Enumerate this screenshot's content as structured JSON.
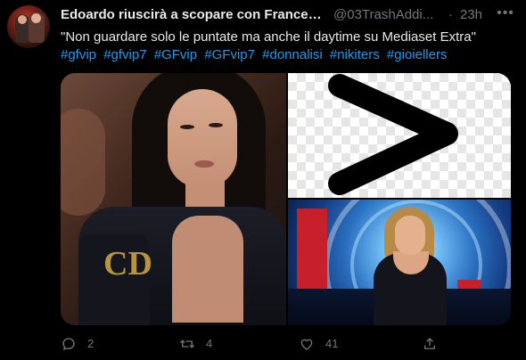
{
  "author": {
    "display_name": "Edoardo riuscirà a scopare con Frances...",
    "handle": "@03TrashAddi...",
    "separator": "·",
    "timestamp": "23h"
  },
  "tweet": {
    "text": "\"Non guardare solo le puntate ma anche il daytime su Mediaset Extra\"",
    "hashtags": [
      "#gfvip",
      "#gfvip7",
      "#GFvip",
      "#GFvip7",
      "#donnalisi",
      "#nikiters",
      "#gioiellers"
    ]
  },
  "media": {
    "images": [
      {
        "name": "woman-dark-hair-photo",
        "logo_text": "CD"
      },
      {
        "name": "greater-than-symbol-image"
      },
      {
        "name": "studio-host-photo"
      }
    ]
  },
  "actions": {
    "reply_count": "2",
    "retweet_count": "4",
    "like_count": "41"
  },
  "colors": {
    "background": "#000000",
    "text": "#e7e9ea",
    "secondary": "#71767b",
    "link": "#1d9bf0"
  },
  "icons": {
    "more": "more-dots-icon",
    "reply": "reply-icon",
    "retweet": "retweet-icon",
    "like": "heart-icon",
    "share": "share-icon"
  }
}
